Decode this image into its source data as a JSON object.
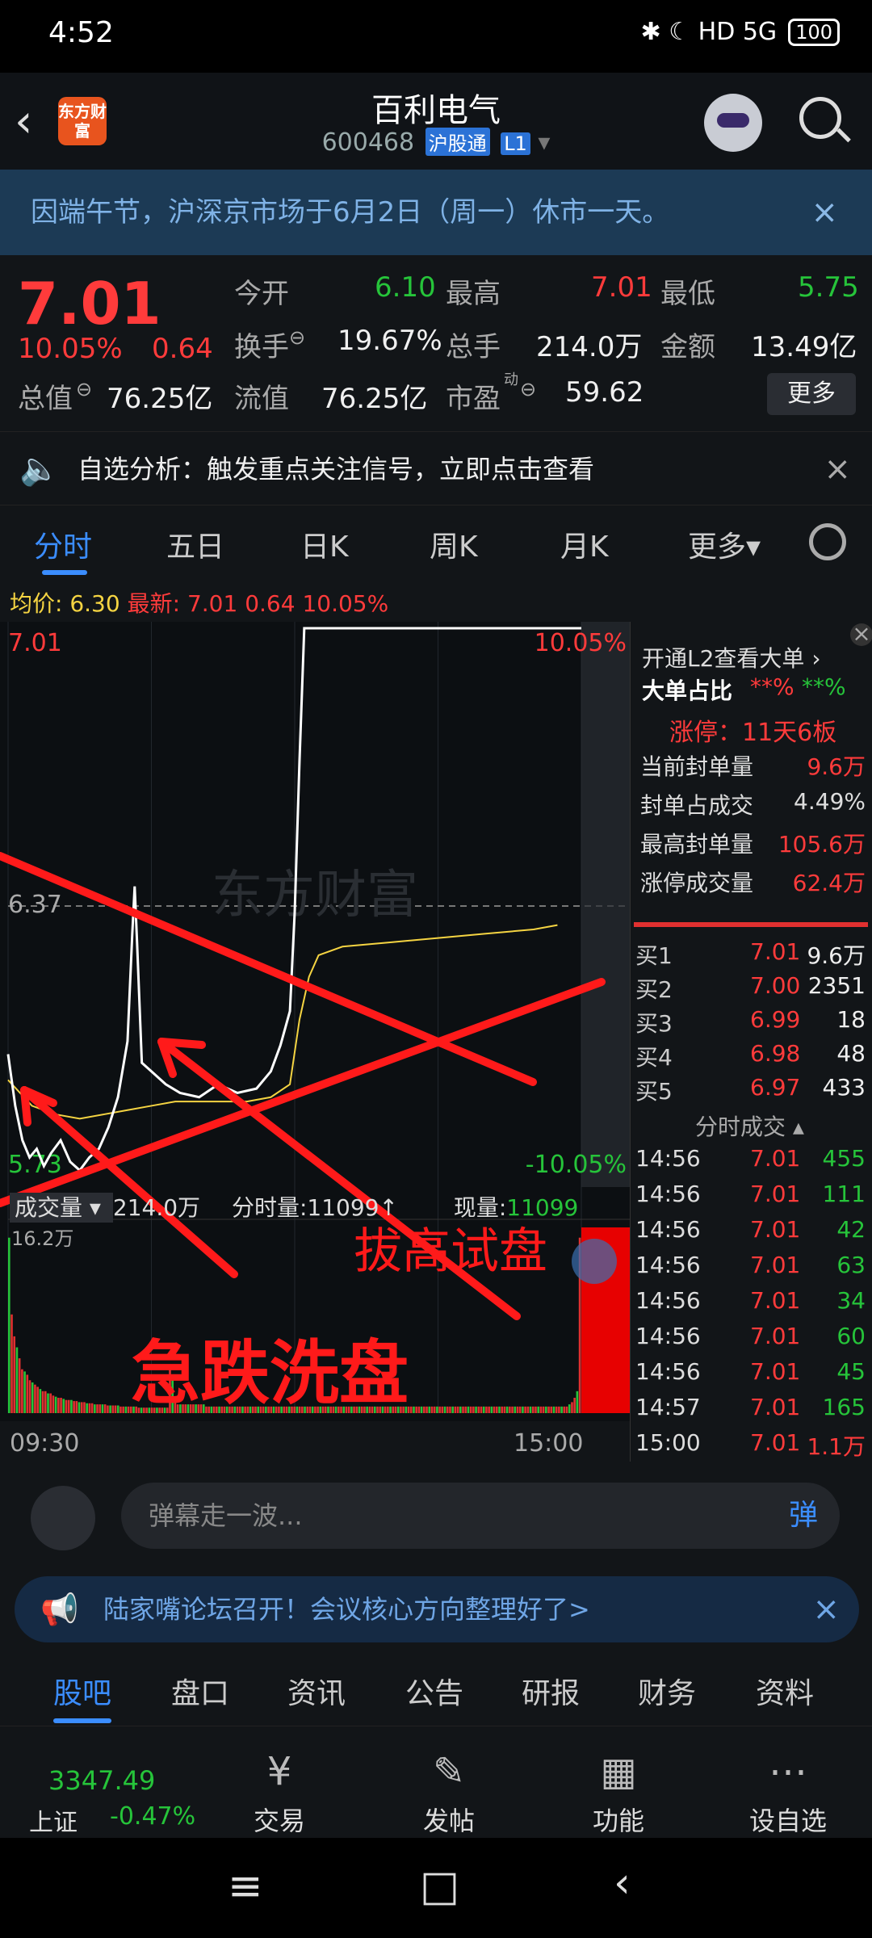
{
  "status": {
    "time": "4:52",
    "icons": "✱ ☾ HD 5G",
    "battery": "100"
  },
  "header": {
    "logo": "东方财富",
    "title": "百利电气",
    "code": "600468",
    "tag1": "沪股通",
    "tag2": "L1"
  },
  "notice": {
    "text": "因端午节，沪深京市场于6月2日（周一）休市一天。",
    "close": "×"
  },
  "quote": {
    "price": "7.01",
    "pct": "10.05%",
    "chg": "0.64",
    "open_label": "今开",
    "open": "6.10",
    "high_label": "最高",
    "high": "7.01",
    "low_label": "最低",
    "low": "5.75",
    "turnover_label": "换手",
    "turnover": "19.67%",
    "volume_label": "总手",
    "volume": "214.0万",
    "amount_label": "金额",
    "amount": "13.49亿",
    "mktcap_label": "总值",
    "mktcap": "76.25亿",
    "float_label": "流值",
    "float": "76.25亿",
    "pe_label": "市盈",
    "pe_sup": "动",
    "pe": "59.62",
    "more": "更多"
  },
  "analysis": {
    "text": "自选分析：触发重点关注信号，立即点击查看",
    "close": "×"
  },
  "chart_tabs": [
    "分时",
    "五日",
    "日K",
    "周K",
    "月K",
    "更多▾"
  ],
  "avg": {
    "label": "均价:",
    "value": "6.30",
    "latest_label": "最新:",
    "latest": "7.01",
    "chg": "0.64",
    "pct": "10.05%"
  },
  "chart_labels": {
    "top_left": "7.01",
    "top_right": "10.05%",
    "mid": "6.37",
    "bottom_left": "5.73",
    "bottom_right": "-10.05%",
    "watermark": "东方财富",
    "vol_max": "16.2万"
  },
  "chart_data": {
    "type": "line",
    "ylim": [
      5.73,
      7.01
    ],
    "series": [
      {
        "name": "price",
        "x": [
          0,
          3,
          6,
          9,
          12,
          15,
          18,
          22,
          26,
          30,
          34,
          38,
          42,
          46,
          50,
          52,
          53,
          54,
          56,
          60,
          66,
          72,
          80,
          88,
          96,
          104,
          110,
          114,
          118,
          120,
          122,
          124,
          130,
          140,
          150,
          160,
          170,
          180,
          190,
          200,
          210,
          220,
          230,
          240
        ],
        "y": [
          6.02,
          5.9,
          5.82,
          5.78,
          5.8,
          5.76,
          5.79,
          5.82,
          5.77,
          5.75,
          5.78,
          5.8,
          5.85,
          5.92,
          6.05,
          6.3,
          6.41,
          6.28,
          6.0,
          5.98,
          5.95,
          5.93,
          5.92,
          5.95,
          5.93,
          5.94,
          5.98,
          6.04,
          6.12,
          6.35,
          6.7,
          7.01,
          7.01,
          7.01,
          7.01,
          7.01,
          7.01,
          7.01,
          7.01,
          7.01,
          7.01,
          7.01,
          7.01,
          7.01
        ]
      },
      {
        "name": "avg",
        "x": [
          0,
          10,
          20,
          30,
          40,
          50,
          60,
          70,
          80,
          90,
          100,
          110,
          118,
          122,
          126,
          130,
          140,
          160,
          180,
          200,
          220,
          230
        ],
        "y": [
          5.96,
          5.9,
          5.88,
          5.87,
          5.88,
          5.89,
          5.9,
          5.91,
          5.91,
          5.91,
          5.91,
          5.92,
          5.95,
          6.1,
          6.2,
          6.25,
          6.27,
          6.28,
          6.29,
          6.3,
          6.31,
          6.32
        ]
      }
    ],
    "volume": [
      160,
      90,
      70,
      60,
      50,
      40,
      38,
      35,
      30,
      28,
      26,
      24,
      22,
      20,
      20,
      18,
      18,
      16,
      15,
      14,
      14,
      13,
      12,
      12,
      12,
      11,
      11,
      10,
      10,
      10,
      9,
      9,
      9,
      8,
      8,
      8,
      8,
      8,
      7,
      7,
      7,
      7,
      7,
      6,
      6,
      6,
      6,
      6,
      6,
      6,
      5,
      5,
      5,
      5,
      5,
      5,
      5,
      5,
      5,
      5,
      5,
      5,
      40,
      30,
      10,
      8,
      8,
      8,
      8,
      8,
      8,
      8,
      8,
      8,
      8,
      8,
      6,
      6,
      6,
      6,
      6,
      6,
      6,
      6,
      6,
      6,
      6,
      6,
      6,
      6,
      6,
      6,
      6,
      6,
      6,
      6,
      6,
      6,
      6,
      6,
      6,
      6,
      6,
      6,
      6,
      6,
      6,
      6,
      6,
      6,
      6,
      6,
      6,
      6,
      6,
      6,
      6,
      6,
      6,
      6,
      6,
      6,
      6,
      6,
      6,
      6,
      6,
      6,
      6,
      6,
      6,
      6,
      6,
      6,
      6,
      6,
      6,
      6,
      6,
      6,
      6,
      6,
      6,
      6,
      6,
      6,
      6,
      6,
      6,
      6,
      6,
      6,
      6,
      6,
      6,
      6,
      6,
      6,
      6,
      6,
      6,
      6,
      6,
      6,
      6,
      6,
      6,
      6,
      6,
      6,
      6,
      6,
      6,
      6,
      6,
      6,
      6,
      6,
      6,
      6,
      6,
      6,
      6,
      6,
      6,
      6,
      6,
      6,
      6,
      6,
      6,
      6,
      6,
      6,
      6,
      6,
      6,
      6,
      6,
      6,
      6,
      6,
      6,
      6,
      6,
      6,
      6,
      6,
      6,
      6,
      6,
      6,
      6,
      6,
      6,
      6,
      8,
      10,
      14,
      20,
      160
    ]
  },
  "annotations": {
    "left": "急跌洗盘",
    "right": "拔高试盘"
  },
  "volume_header": {
    "label": "成交量",
    "value": "214.0万",
    "fenshi_label": "分时量:",
    "fenshi": "11099↑",
    "now_label": "现量:",
    "now": "11099"
  },
  "time_axis": [
    "09:30",
    "15:00"
  ],
  "right_panel": {
    "l2": "开通L2查看大单 ›",
    "big_label": "大单占比",
    "big_a": "**%",
    "big_b": "**%",
    "limit": "涨停：11天6板",
    "rows": [
      {
        "k": "当前封单量",
        "v": "9.6万"
      },
      {
        "k": "封单占成交",
        "v": "4.49%"
      },
      {
        "k": "最高封单量",
        "v": "105.6万"
      },
      {
        "k": "涨停成交量",
        "v": "62.4万"
      }
    ],
    "bids": [
      {
        "k": "买1",
        "p": "7.01",
        "v": "9.6万"
      },
      {
        "k": "买2",
        "p": "7.00",
        "v": "2351"
      },
      {
        "k": "买3",
        "p": "6.99",
        "v": "18"
      },
      {
        "k": "买4",
        "p": "6.98",
        "v": "48"
      },
      {
        "k": "买5",
        "p": "6.97",
        "v": "433"
      }
    ],
    "trades_title": "分时成交 ▴",
    "trades": [
      {
        "t": "14:56",
        "p": "7.01",
        "v": "455"
      },
      {
        "t": "14:56",
        "p": "7.01",
        "v": "111"
      },
      {
        "t": "14:56",
        "p": "7.01",
        "v": "42"
      },
      {
        "t": "14:56",
        "p": "7.01",
        "v": "63"
      },
      {
        "t": "14:56",
        "p": "7.01",
        "v": "34"
      },
      {
        "t": "14:56",
        "p": "7.01",
        "v": "60"
      },
      {
        "t": "14:56",
        "p": "7.01",
        "v": "45"
      },
      {
        "t": "14:57",
        "p": "7.01",
        "v": "165"
      },
      {
        "t": "15:00",
        "p": "7.01",
        "v": "1.1万"
      }
    ]
  },
  "danmu": {
    "placeholder": "弹幕走一波...",
    "btn": "弹"
  },
  "ad": {
    "text": "陆家嘴论坛召开！会议核心方向整理好了>",
    "close": "×"
  },
  "bottom_tabs": [
    "股吧",
    "盘口",
    "资讯",
    "公告",
    "研报",
    "财务",
    "资料"
  ],
  "nav": {
    "index_value": "3347.49",
    "index_name": "上证",
    "index_pct": "-0.47%",
    "items": [
      "交易",
      "发帖",
      "功能",
      "设自选"
    ]
  },
  "colors": {
    "up": "#ff3b3b",
    "down": "#26c43a",
    "accent": "#3b8dff",
    "avg": "#f5d442"
  }
}
